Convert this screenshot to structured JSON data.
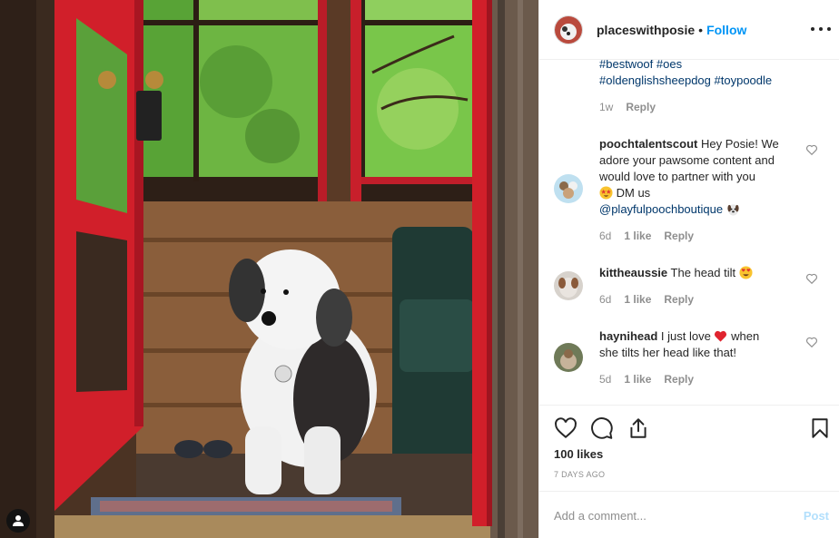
{
  "post": {
    "image_alt": "Black and white dog standing in a red doorway of a log cabin"
  },
  "header": {
    "username": "placeswithposie",
    "separator": "•",
    "follow_label": "Follow",
    "more_icon": "more-options-icon"
  },
  "caption": {
    "tags_line1": [
      "#bestwoof",
      "#oes"
    ],
    "tags_line2": [
      "#oldenglishsheepdog",
      "#toypoodle"
    ],
    "time": "1w",
    "reply_label": "Reply"
  },
  "comments": [
    {
      "username": "poochtalentscout",
      "text_line1": "Hey Posie! We",
      "text_line2": "adore your pawsome content and",
      "text_line3": "would love to partner with you",
      "text_line4": "DM us",
      "mention": "@playfulpoochboutique",
      "time": "6d",
      "likes": "1 like",
      "reply_label": "Reply",
      "emoji": [
        "star-struck-emoji",
        "dog-emoji"
      ]
    },
    {
      "username": "kittheaussie",
      "text": "The head tilt",
      "time": "6d",
      "likes": "1 like",
      "reply_label": "Reply",
      "emoji": [
        "heart-eyes-emoji"
      ]
    },
    {
      "username": "haynihead",
      "text_before": "I just love",
      "text_after": "when",
      "text_line2": "she tilts her head like that!",
      "time": "5d",
      "likes": "1 like",
      "reply_label": "Reply",
      "emoji": [
        "red-heart-emoji"
      ]
    }
  ],
  "actions": {
    "likes": "100 likes",
    "date": "7 DAYS AGO",
    "icons": [
      "like-icon",
      "comment-icon",
      "share-icon",
      "save-icon"
    ]
  },
  "composer": {
    "placeholder": "Add a comment...",
    "post_label": "Post"
  },
  "colors": {
    "link_blue": "#0095f6",
    "hashtag_blue": "#00376b",
    "muted_gray": "#8e8e8e",
    "door_red": "#d11f2a"
  }
}
